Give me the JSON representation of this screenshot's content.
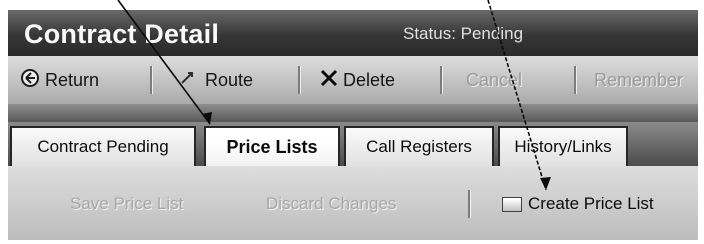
{
  "header": {
    "title": "Contract Detail",
    "status": "Status: Pending"
  },
  "toolbar": {
    "return_label": "Return",
    "route_label": "Route",
    "delete_label": "Delete",
    "cancel_label": "Cancel",
    "remember_label": "Remember"
  },
  "tabs": [
    {
      "label": "Contract Pending",
      "active": false
    },
    {
      "label": "Price Lists",
      "active": true
    },
    {
      "label": "Call Registers",
      "active": false
    },
    {
      "label": "History/Links",
      "active": false
    }
  ],
  "price_list_actions": {
    "save_label": "Save Price List",
    "discard_label": "Discard Changes",
    "create_label": "Create Price List"
  },
  "icons": {
    "return": "return-icon",
    "route": "route-icon",
    "delete": "delete-icon",
    "create": "document-icon"
  }
}
